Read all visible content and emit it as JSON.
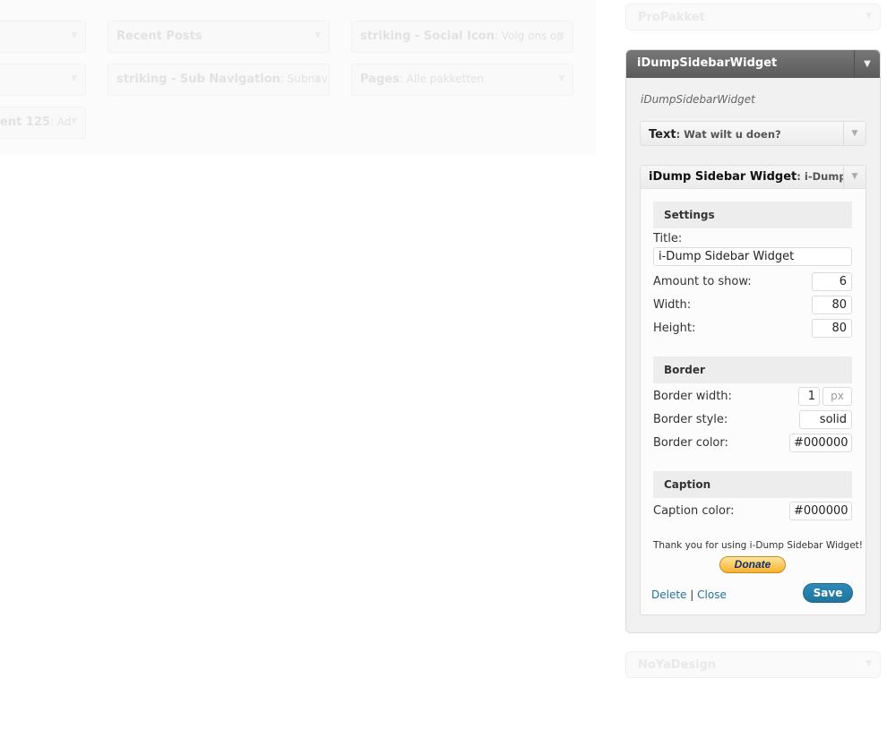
{
  "background_widgets": [
    {
      "title": "",
      "subtitle": ""
    },
    {
      "title": "Recent Posts",
      "subtitle": ""
    },
    {
      "title": "striking - Social Icon",
      "subtitle": ": Volg ons op"
    },
    {
      "title": "",
      "subtitle": ""
    },
    {
      "title": "striking - Sub Navigation",
      "subtitle": ": Subnav"
    },
    {
      "title": "Pages",
      "subtitle": ": Alle pakketten"
    },
    {
      "title": "ent 125",
      "subtitle": ": Ad"
    }
  ],
  "sidebars": {
    "propakket": "ProPakket",
    "noyadesign": "NoYaDesign",
    "active": {
      "title": "iDumpSidebarWidget",
      "description": "iDumpSidebarWidget"
    }
  },
  "text_widget": {
    "title": "Text",
    "subtitle": ": Wat wilt u doen?"
  },
  "idump_widget": {
    "title": "iDump Sidebar Widget",
    "subtitle": ": i-Dump Sidebar Widget",
    "settings": {
      "heading": "Settings",
      "title_label": "Title:",
      "title_value": "i-Dump Sidebar Widget",
      "amount_label": "Amount to show:",
      "amount_value": "6",
      "width_label": "Width:",
      "width_value": "80",
      "height_label": "Height:",
      "height_value": "80"
    },
    "border": {
      "heading": "Border",
      "width_label": "Border width:",
      "width_value": "1",
      "width_unit": "px",
      "style_label": "Border style:",
      "style_value": "solid",
      "color_label": "Border color:",
      "color_value": "#000000"
    },
    "caption": {
      "heading": "Caption",
      "color_label": "Caption color:",
      "color_value": "#000000"
    },
    "thanks": "Thank you for using i-Dump Sidebar Widget!",
    "donate": "Donate",
    "delete": "Delete",
    "separator": "|",
    "close": "Close",
    "save": "Save"
  },
  "icons": {
    "toggle": "triangle-down-icon"
  },
  "colors": {
    "header": "#5b5b5b",
    "link": "#21759b",
    "save": "#21759b"
  }
}
